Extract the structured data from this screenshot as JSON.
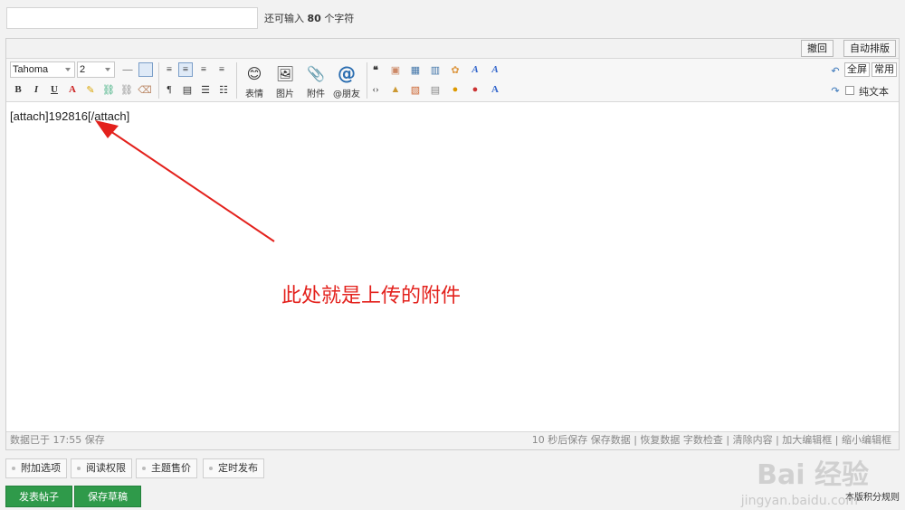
{
  "header": {
    "title_input_value": "",
    "char_hint_prefix": "还可输入",
    "char_hint_count": "80",
    "char_hint_suffix": "个字符"
  },
  "editor_top": {
    "undo_label": "撤回",
    "autoformat_label": "自动排版"
  },
  "toolbar": {
    "font_family": "Tahoma",
    "font_size": "2",
    "emoji_label": "表情",
    "image_label": "图片",
    "attach_label": "附件",
    "friend_label": "@朋友",
    "fullscreen_label": "全屏",
    "common_label": "常用",
    "plaintext_label": "纯文本"
  },
  "content": {
    "body_text": "[attach]192816[/attach]",
    "annotation": "此处就是上传的附件",
    "annotation_color": "#e3211c"
  },
  "status": {
    "left": "数据已于 17:55 保存",
    "right": "10 秒后保存 保存数据 | 恢复数据   字数检查 | 清除内容 | 加大编辑框 | 缩小编辑框"
  },
  "options": [
    {
      "label": "附加选项"
    },
    {
      "label": "阅读权限"
    },
    {
      "label": "主题售价"
    },
    {
      "label": "定时发布"
    }
  ],
  "actions": {
    "post_label": "发表帖子",
    "draft_label": "保存草稿",
    "accent": "#2f9a4a",
    "rules_label": "本版积分规则"
  },
  "watermark": {
    "brand": "Bai 经验",
    "url": "jingyan.baidu.com"
  }
}
